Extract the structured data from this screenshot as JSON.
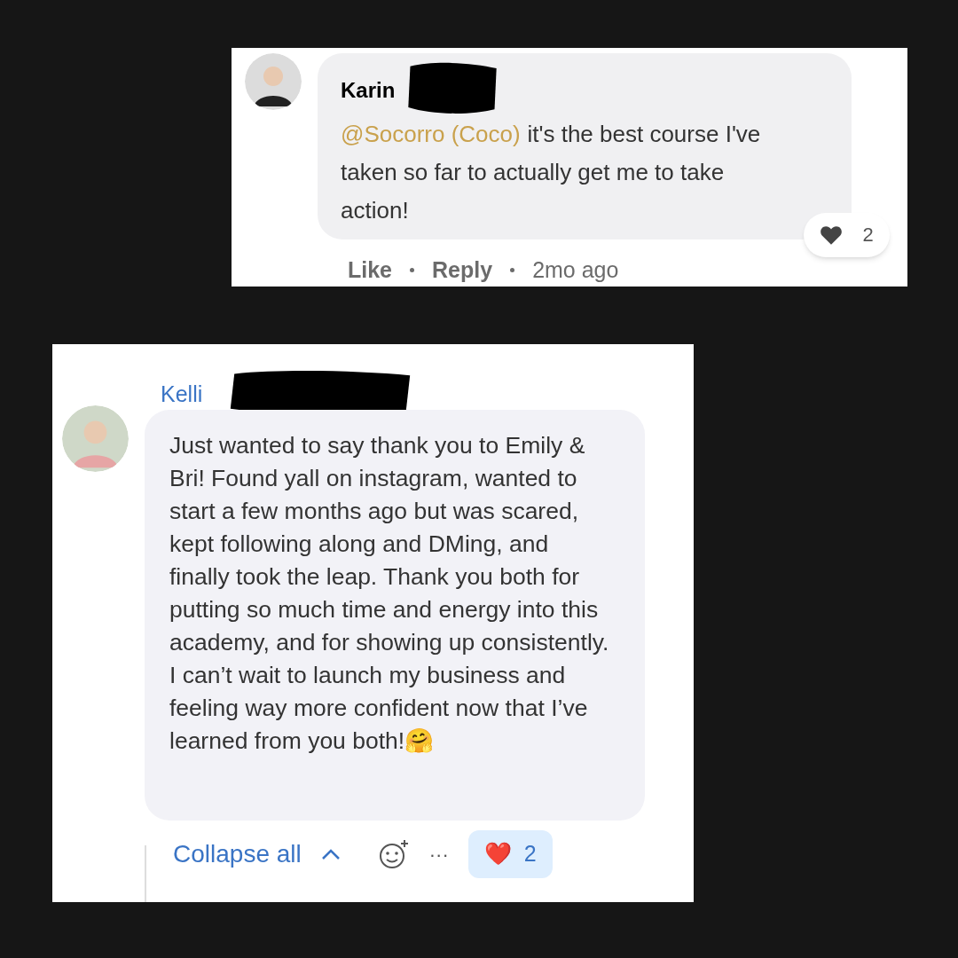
{
  "comment_top": {
    "author": "Karin",
    "mention": "@Socorro (Coco)",
    "text": "it's the best course I've taken so far to actually get me to take action!",
    "like_count": "2",
    "actions": [
      "Like",
      "Reply"
    ],
    "time": "2mo ago"
  },
  "comment_bottom": {
    "author": "Kelli",
    "text": "Just wanted to say thank you to Emily & Bri! Found yall on instagram, wanted to start a few months ago but was scared, kept following along and DMing, and finally took the leap. Thank you both for putting so much time and energy into this academy, and for showing up consistently. I can’t wait to launch my business and feeling way more confident now that I’ve learned from you both!🤗",
    "collapse": "Collapse all",
    "more": "···",
    "reaction": {
      "emoji": "❤️",
      "count": "2"
    }
  }
}
